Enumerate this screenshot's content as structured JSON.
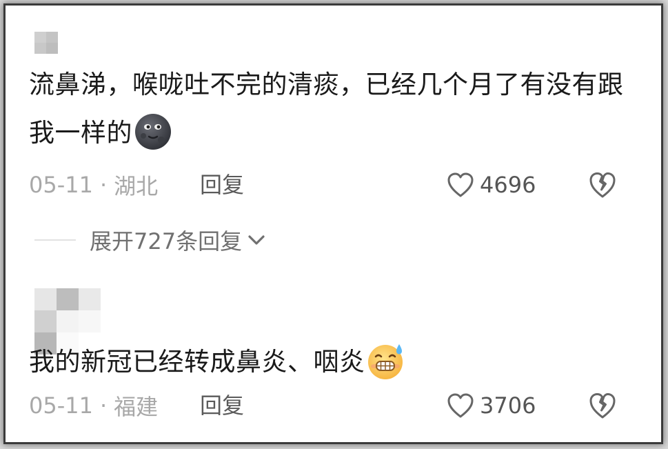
{
  "comments": [
    {
      "text": "流鼻涕，喉咙吐不完的清痰，已经几个月了有没有跟我一样的",
      "emoji": "new-moon-face",
      "date": "05-11",
      "location": "湖北",
      "reply_label": "回复",
      "likes": "4696",
      "expand_label": "展开727条回复"
    },
    {
      "text": "我的新冠已经转成鼻炎、咽炎",
      "emoji": "grinning-sweat-face",
      "date": "05-11",
      "location": "福建",
      "reply_label": "回复",
      "likes": "3706"
    }
  ],
  "separator": "·",
  "icons": {
    "like": "heart-outline-icon",
    "dislike": "broken-heart-icon",
    "expand": "chevron-down-icon"
  },
  "colors": {
    "text": "#1a1a1a",
    "meta": "#a8a8a8",
    "action": "#5a5a5a",
    "frame_border": "#3a3a3a"
  }
}
